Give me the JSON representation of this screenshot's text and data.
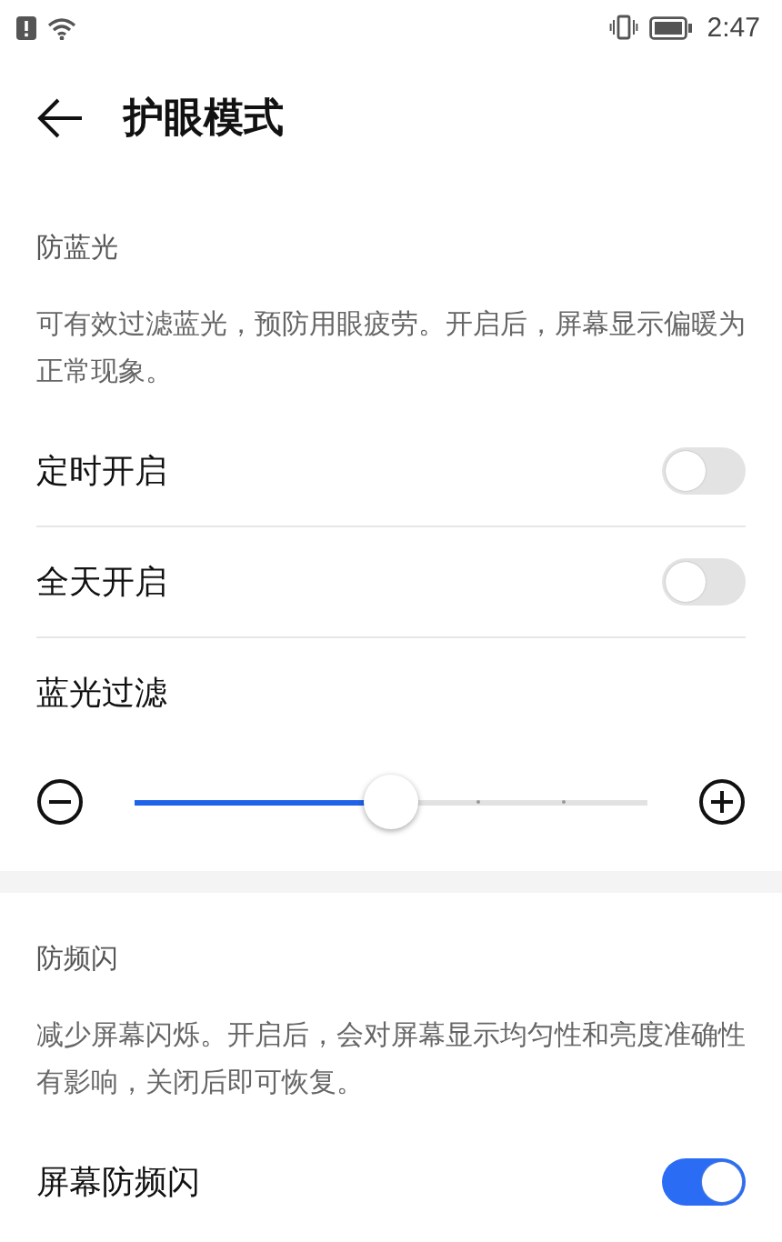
{
  "status_bar": {
    "time": "2:47"
  },
  "header": {
    "title": "护眼模式"
  },
  "sections": [
    {
      "title": "防蓝光",
      "description": "可有效过滤蓝光，预防用眼疲劳。开启后，屏幕显示偏暖为正常现象。",
      "items": [
        {
          "kind": "switch",
          "label": "定时开启",
          "on": false
        },
        {
          "kind": "switch",
          "label": "全天开启",
          "on": false
        },
        {
          "kind": "slider",
          "label": "蓝光过滤",
          "level": 0.5
        }
      ]
    },
    {
      "title": "防频闪",
      "description": "减少屏幕闪烁。开启后，会对屏幕显示均匀性和亮度准确性有影响，关闭后即可恢复。",
      "items": [
        {
          "kind": "switch",
          "label": "屏幕防频闪",
          "on": true
        }
      ]
    }
  ]
}
